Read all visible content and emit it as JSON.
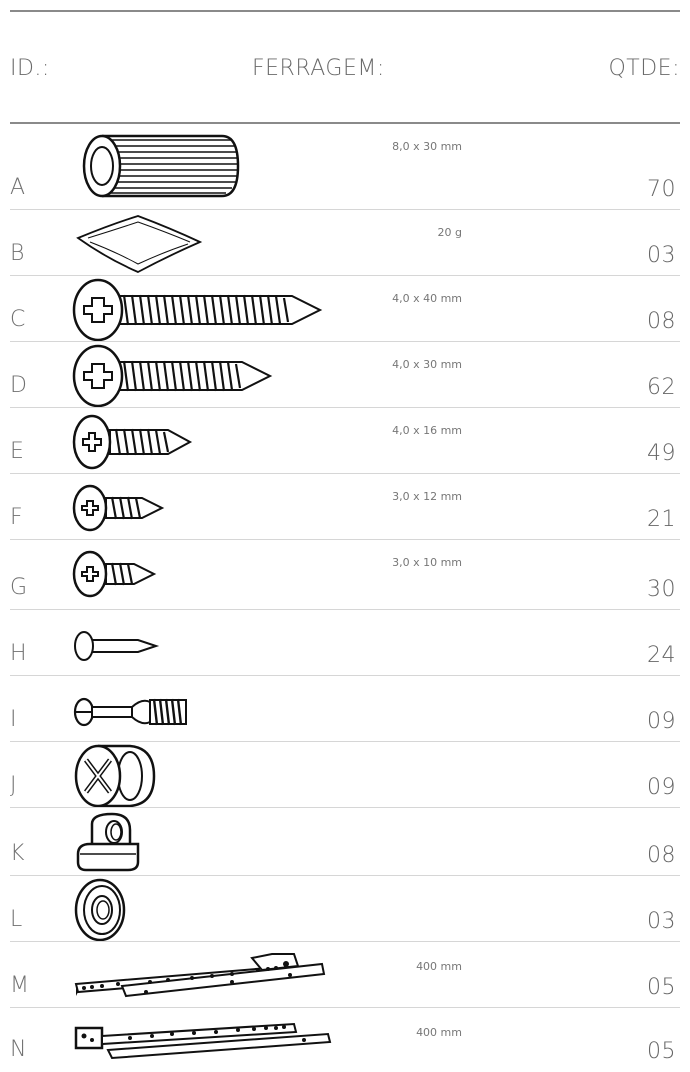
{
  "header": {
    "id": "ID.:",
    "hardware": "FERRAGEM:",
    "qty": "QTDE:"
  },
  "items": [
    {
      "id": "A",
      "spec": "8,0 x 30 mm",
      "qty": "70",
      "icon": "wooden-dowel-icon"
    },
    {
      "id": "B",
      "spec": "20 g",
      "qty": "03",
      "icon": "glue-sachet-icon"
    },
    {
      "id": "C",
      "spec": "4,0 x 40 mm",
      "qty": "08",
      "icon": "screw-icon"
    },
    {
      "id": "D",
      "spec": "4,0 x 30 mm",
      "qty": "62",
      "icon": "screw-icon"
    },
    {
      "id": "E",
      "spec": "4,0 x 16 mm",
      "qty": "49",
      "icon": "screw-icon"
    },
    {
      "id": "F",
      "spec": "3,0 x 12 mm",
      "qty": "21",
      "icon": "screw-icon"
    },
    {
      "id": "G",
      "spec": "3,0 x 10 mm",
      "qty": "30",
      "icon": "screw-icon"
    },
    {
      "id": "H",
      "spec": "",
      "qty": "24",
      "icon": "nail-icon"
    },
    {
      "id": "I",
      "spec": "",
      "qty": "09",
      "icon": "cam-bolt-icon"
    },
    {
      "id": "J",
      "spec": "",
      "qty": "09",
      "icon": "cam-lock-icon"
    },
    {
      "id": "K",
      "spec": "",
      "qty": "08",
      "icon": "shelf-support-icon"
    },
    {
      "id": "L",
      "spec": "",
      "qty": "03",
      "icon": "cover-cap-icon"
    },
    {
      "id": "M",
      "spec": "400 mm",
      "qty": "05",
      "icon": "drawer-slide-icon"
    },
    {
      "id": "N",
      "spec": "400 mm",
      "qty": "05",
      "icon": "drawer-slide-icon"
    }
  ]
}
